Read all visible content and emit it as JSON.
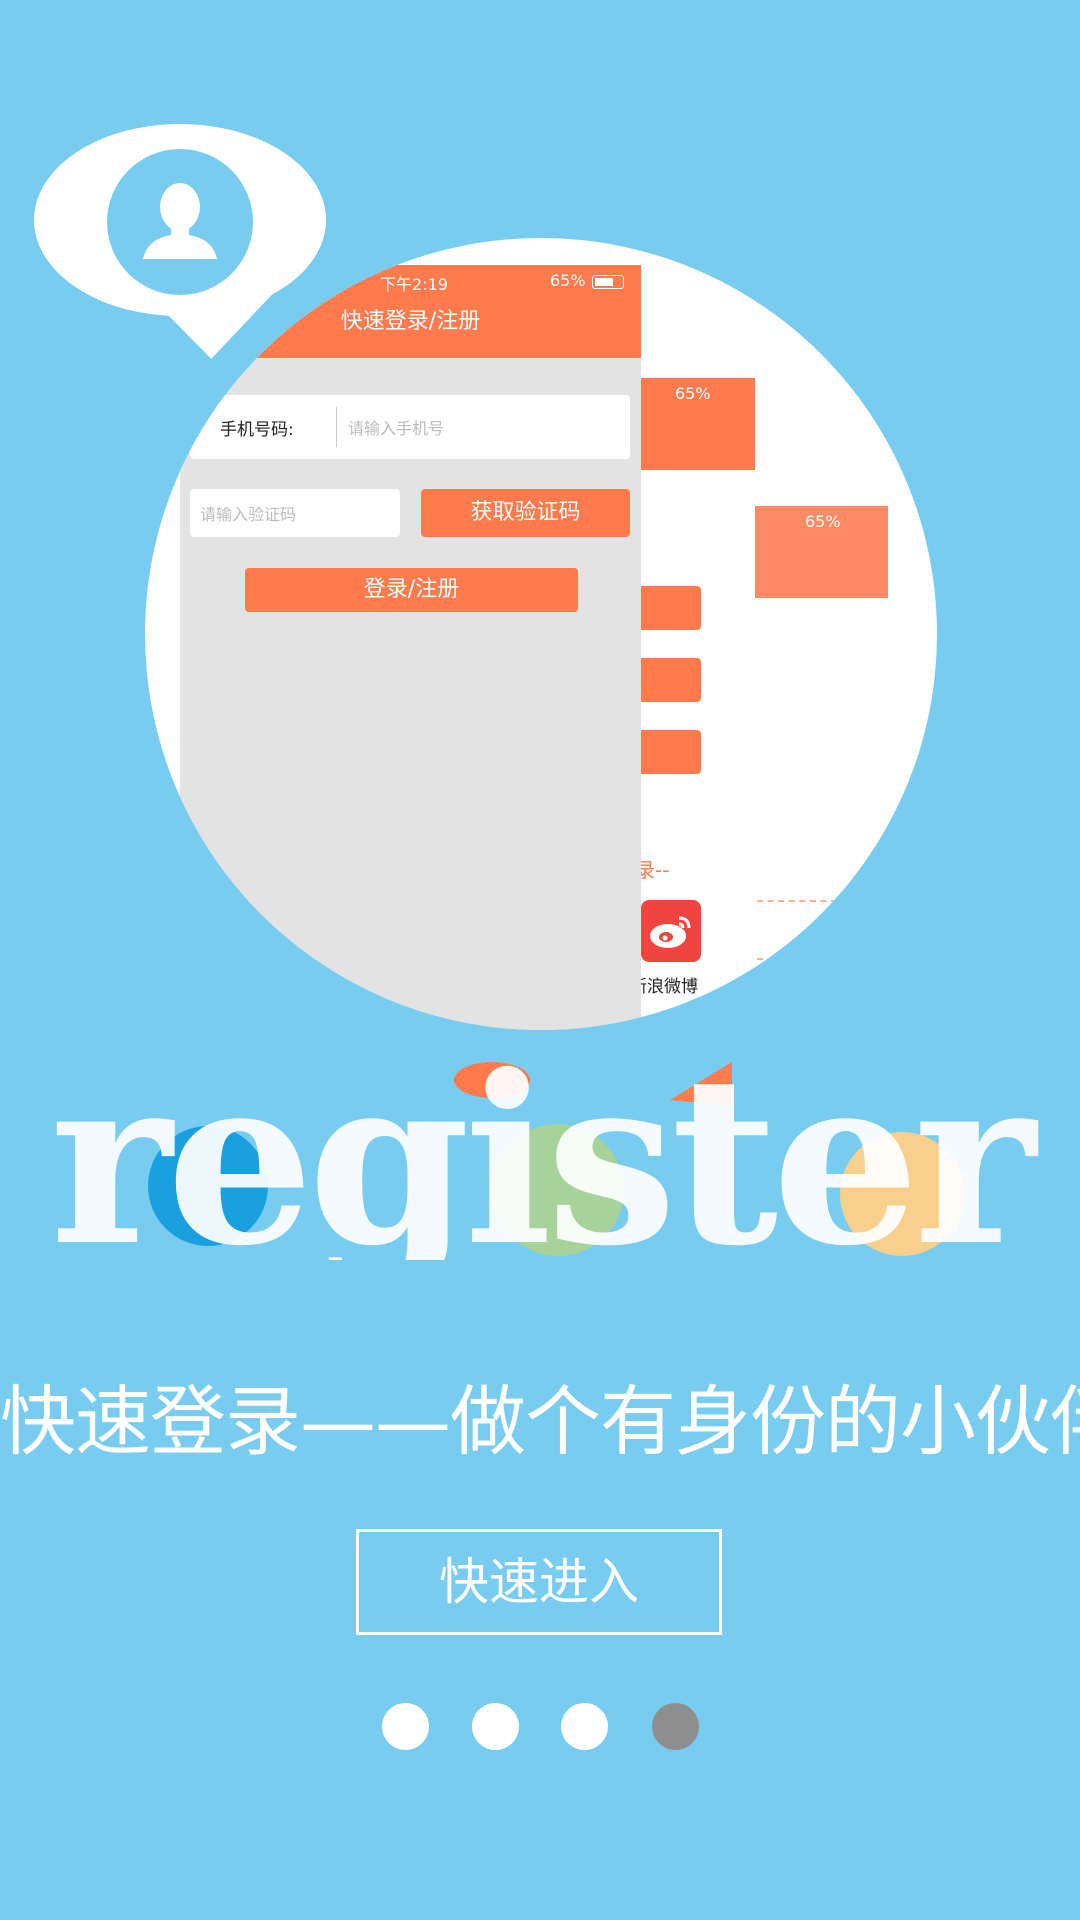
{
  "phone_card": {
    "status_time": "下午2:19",
    "battery": "65%",
    "title": "快速登录/注册",
    "phone_label": "手机号码:",
    "phone_placeholder": "请输入手机号",
    "code_placeholder": "请输入验证码",
    "get_code_button": "获取验证码",
    "login_button": "登录/注册"
  },
  "background_screens": {
    "battery_1": "65%",
    "battery_2": "65%",
    "or_text": "录--",
    "weibo_label": "新浪微博"
  },
  "hero_word": "register",
  "slogan": "快速登录——做个有身份的小伙伴",
  "enter_button": "快速进入",
  "page_indicator": {
    "total": 4,
    "active_index": 3
  },
  "colors": {
    "background": "#78ccef",
    "accent": "#ff7a4d",
    "inactive_dot": "#8e8e8e"
  }
}
